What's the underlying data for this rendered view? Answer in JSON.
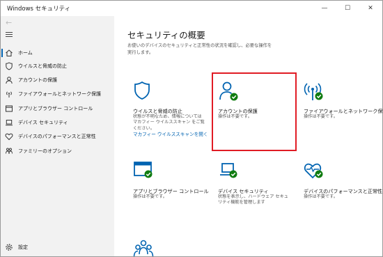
{
  "window": {
    "title": "Windows セキュリティ",
    "minimize": "—",
    "maximize": "☐",
    "close": "✕"
  },
  "sidebar": {
    "back_label": "←",
    "items": [
      {
        "label": "ホーム",
        "icon": "home-icon",
        "active": true
      },
      {
        "label": "ウイルスと脅威の防止",
        "icon": "shield-icon"
      },
      {
        "label": "アカウントの保護",
        "icon": "person-icon"
      },
      {
        "label": "ファイアウォールとネットワーク保護",
        "icon": "antenna-icon"
      },
      {
        "label": "アプリとブラウザー コントロール",
        "icon": "app-window-icon"
      },
      {
        "label": "デバイス セキュリティ",
        "icon": "laptop-icon"
      },
      {
        "label": "デバイスのパフォーマンスと正常性",
        "icon": "heart-icon"
      },
      {
        "label": "ファミリーのオプション",
        "icon": "family-icon"
      }
    ],
    "settings_label": "設定"
  },
  "main": {
    "title": "セキュリティの概要",
    "description": "お使いのデバイスのセキュリティと正常性の状況を確認し、必要な操作を実行します。",
    "cards": [
      {
        "title": "ウイルスと脅威の防止",
        "desc": "状態が不明なため、情報については マカフィー ウイルススキャン をご覧ください。",
        "link": "マカフィー ウイルススキャンを開く",
        "icon": "shield-icon"
      },
      {
        "title": "アカウントの保護",
        "desc": "操作は不要です。",
        "icon": "account-check-icon"
      },
      {
        "title": "ファイアウォールとネットワーク保護",
        "desc": "操作は不要です。",
        "icon": "antenna-check-icon"
      },
      {
        "title": "アプリとブラウザー コントロール",
        "desc": "操作は不要です。",
        "icon": "app-window-check-icon"
      },
      {
        "title": "デバイス セキュリティ",
        "desc": "状態を表示し、ハードウェア セキュリティ機能を管理します",
        "icon": "laptop-check-icon"
      },
      {
        "title": "デバイスのパフォーマンスと正常性",
        "desc": "操作は不要です。",
        "icon": "heart-check-icon"
      },
      {
        "title": "",
        "desc": "",
        "icon": "family-icon"
      }
    ]
  },
  "colors": {
    "accent": "#0063b1",
    "check": "#107c10",
    "highlight": "#e01b24",
    "sidebar_bg": "#f2f2f2"
  }
}
